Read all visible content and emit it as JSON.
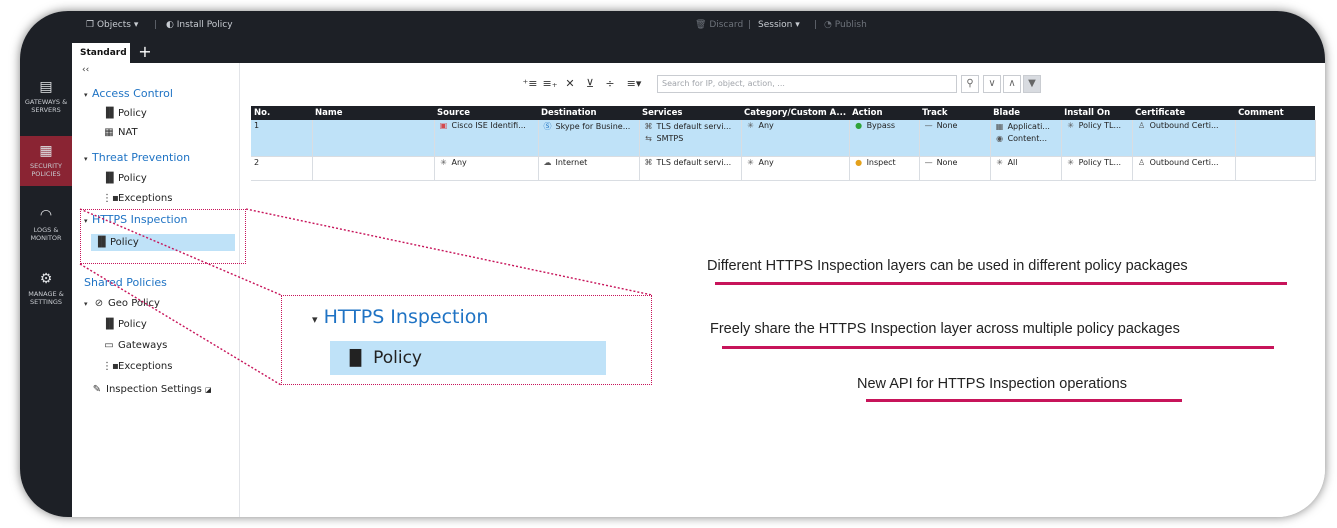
{
  "topbar": {
    "objects_label": "Objects ▾",
    "install_policy_label": "Install Policy",
    "discard_label": "Discard",
    "session_label": "Session ▾",
    "publish_label": "Publish"
  },
  "tabs": {
    "active": "Standard",
    "add": "+"
  },
  "leftnav": [
    {
      "label": "GATEWAYS & SERVERS",
      "icon": "gateways-icon"
    },
    {
      "label": "SECURITY POLICIES",
      "icon": "security-policies-icon",
      "active": true
    },
    {
      "label": "LOGS & MONITOR",
      "icon": "logs-monitor-icon"
    },
    {
      "label": "MANAGE & SETTINGS",
      "icon": "manage-settings-icon"
    }
  ],
  "tree": {
    "collapse": "‹‹",
    "access_control": "Access Control",
    "ac_policy": "Policy",
    "ac_nat": "NAT",
    "threat_prevention": "Threat Prevention",
    "tp_policy": "Policy",
    "tp_exceptions": "Exceptions",
    "https_inspection": "HTTPS Inspection",
    "hi_policy": "Policy",
    "shared_policies": "Shared Policies",
    "geo_policy": "Geo Policy",
    "geo_policy_sub": "Policy",
    "gateways": "Gateways",
    "exceptions": "Exceptions",
    "inspection_settings": "Inspection Settings"
  },
  "search": {
    "placeholder": "Search for IP, object, action, ..."
  },
  "table": {
    "headers": [
      "No.",
      "Name",
      "Source",
      "Destination",
      "Services",
      "Category/Custom A...",
      "Action",
      "Track",
      "Blade",
      "Install On",
      "Certificate",
      "Comment"
    ],
    "rows": [
      {
        "no": "1",
        "name": "",
        "source": "Cisco ISE Identifi...",
        "destination": "Skype for Busine...",
        "services": [
          "TLS default servi...",
          "SMTPS"
        ],
        "category": "Any",
        "action": "Bypass",
        "track": "None",
        "blade": [
          "Applicati...",
          "Content..."
        ],
        "install_on": "Policy TL...",
        "certificate": "Outbound Certi...",
        "comment": ""
      },
      {
        "no": "2",
        "name": "",
        "source": "Any",
        "destination": "Internet",
        "services": [
          "TLS default servi..."
        ],
        "category": "Any",
        "action": "Inspect",
        "track": "None",
        "blade": [
          "All"
        ],
        "install_on": "Policy TL...",
        "certificate": "Outbound Certi...",
        "comment": ""
      }
    ]
  },
  "zoom": {
    "header": "HTTPS Inspection",
    "item": "Policy"
  },
  "notes": [
    "Different HTTPS Inspection layers can be used in different policy packages",
    "Freely share the HTTPS Inspection layer across multiple policy packages",
    "New API for HTTPS Inspection operations"
  ],
  "colors": {
    "accent": "#c7145a",
    "active_nav": "#8a2433",
    "selection": "#bfe2f8",
    "link": "#1f73c4"
  }
}
